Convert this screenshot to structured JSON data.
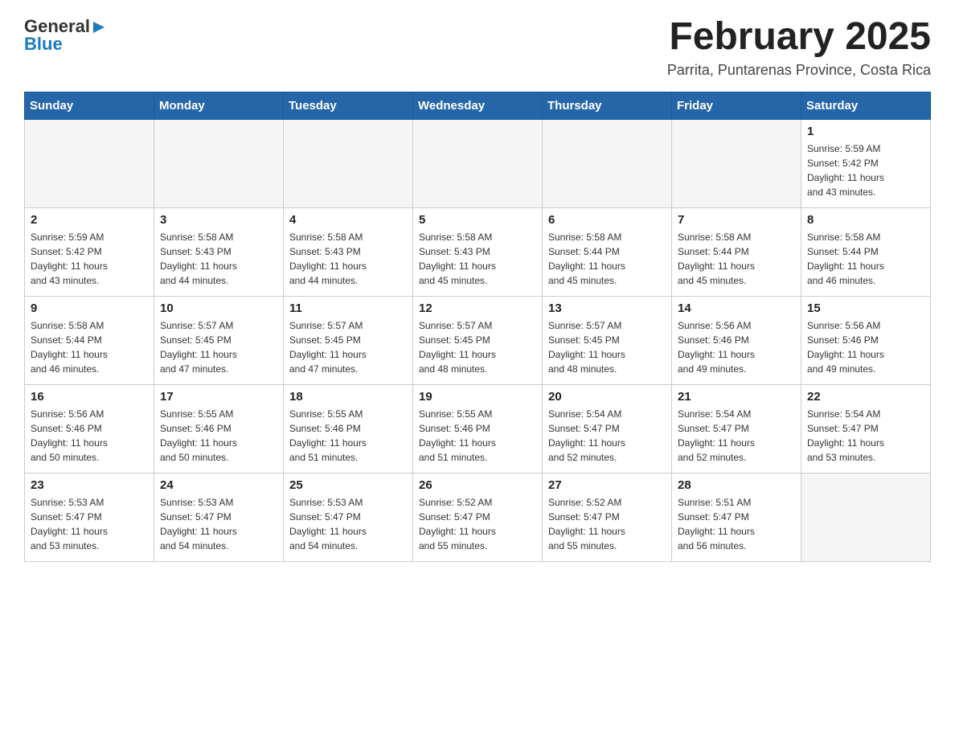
{
  "header": {
    "logo_general": "General",
    "logo_blue": "Blue",
    "title": "February 2025",
    "subtitle": "Parrita, Puntarenas Province, Costa Rica"
  },
  "weekdays": [
    "Sunday",
    "Monday",
    "Tuesday",
    "Wednesday",
    "Thursday",
    "Friday",
    "Saturday"
  ],
  "weeks": [
    [
      {
        "day": "",
        "info": ""
      },
      {
        "day": "",
        "info": ""
      },
      {
        "day": "",
        "info": ""
      },
      {
        "day": "",
        "info": ""
      },
      {
        "day": "",
        "info": ""
      },
      {
        "day": "",
        "info": ""
      },
      {
        "day": "1",
        "info": "Sunrise: 5:59 AM\nSunset: 5:42 PM\nDaylight: 11 hours\nand 43 minutes."
      }
    ],
    [
      {
        "day": "2",
        "info": "Sunrise: 5:59 AM\nSunset: 5:42 PM\nDaylight: 11 hours\nand 43 minutes."
      },
      {
        "day": "3",
        "info": "Sunrise: 5:58 AM\nSunset: 5:43 PM\nDaylight: 11 hours\nand 44 minutes."
      },
      {
        "day": "4",
        "info": "Sunrise: 5:58 AM\nSunset: 5:43 PM\nDaylight: 11 hours\nand 44 minutes."
      },
      {
        "day": "5",
        "info": "Sunrise: 5:58 AM\nSunset: 5:43 PM\nDaylight: 11 hours\nand 45 minutes."
      },
      {
        "day": "6",
        "info": "Sunrise: 5:58 AM\nSunset: 5:44 PM\nDaylight: 11 hours\nand 45 minutes."
      },
      {
        "day": "7",
        "info": "Sunrise: 5:58 AM\nSunset: 5:44 PM\nDaylight: 11 hours\nand 45 minutes."
      },
      {
        "day": "8",
        "info": "Sunrise: 5:58 AM\nSunset: 5:44 PM\nDaylight: 11 hours\nand 46 minutes."
      }
    ],
    [
      {
        "day": "9",
        "info": "Sunrise: 5:58 AM\nSunset: 5:44 PM\nDaylight: 11 hours\nand 46 minutes."
      },
      {
        "day": "10",
        "info": "Sunrise: 5:57 AM\nSunset: 5:45 PM\nDaylight: 11 hours\nand 47 minutes."
      },
      {
        "day": "11",
        "info": "Sunrise: 5:57 AM\nSunset: 5:45 PM\nDaylight: 11 hours\nand 47 minutes."
      },
      {
        "day": "12",
        "info": "Sunrise: 5:57 AM\nSunset: 5:45 PM\nDaylight: 11 hours\nand 48 minutes."
      },
      {
        "day": "13",
        "info": "Sunrise: 5:57 AM\nSunset: 5:45 PM\nDaylight: 11 hours\nand 48 minutes."
      },
      {
        "day": "14",
        "info": "Sunrise: 5:56 AM\nSunset: 5:46 PM\nDaylight: 11 hours\nand 49 minutes."
      },
      {
        "day": "15",
        "info": "Sunrise: 5:56 AM\nSunset: 5:46 PM\nDaylight: 11 hours\nand 49 minutes."
      }
    ],
    [
      {
        "day": "16",
        "info": "Sunrise: 5:56 AM\nSunset: 5:46 PM\nDaylight: 11 hours\nand 50 minutes."
      },
      {
        "day": "17",
        "info": "Sunrise: 5:55 AM\nSunset: 5:46 PM\nDaylight: 11 hours\nand 50 minutes."
      },
      {
        "day": "18",
        "info": "Sunrise: 5:55 AM\nSunset: 5:46 PM\nDaylight: 11 hours\nand 51 minutes."
      },
      {
        "day": "19",
        "info": "Sunrise: 5:55 AM\nSunset: 5:46 PM\nDaylight: 11 hours\nand 51 minutes."
      },
      {
        "day": "20",
        "info": "Sunrise: 5:54 AM\nSunset: 5:47 PM\nDaylight: 11 hours\nand 52 minutes."
      },
      {
        "day": "21",
        "info": "Sunrise: 5:54 AM\nSunset: 5:47 PM\nDaylight: 11 hours\nand 52 minutes."
      },
      {
        "day": "22",
        "info": "Sunrise: 5:54 AM\nSunset: 5:47 PM\nDaylight: 11 hours\nand 53 minutes."
      }
    ],
    [
      {
        "day": "23",
        "info": "Sunrise: 5:53 AM\nSunset: 5:47 PM\nDaylight: 11 hours\nand 53 minutes."
      },
      {
        "day": "24",
        "info": "Sunrise: 5:53 AM\nSunset: 5:47 PM\nDaylight: 11 hours\nand 54 minutes."
      },
      {
        "day": "25",
        "info": "Sunrise: 5:53 AM\nSunset: 5:47 PM\nDaylight: 11 hours\nand 54 minutes."
      },
      {
        "day": "26",
        "info": "Sunrise: 5:52 AM\nSunset: 5:47 PM\nDaylight: 11 hours\nand 55 minutes."
      },
      {
        "day": "27",
        "info": "Sunrise: 5:52 AM\nSunset: 5:47 PM\nDaylight: 11 hours\nand 55 minutes."
      },
      {
        "day": "28",
        "info": "Sunrise: 5:51 AM\nSunset: 5:47 PM\nDaylight: 11 hours\nand 56 minutes."
      },
      {
        "day": "",
        "info": ""
      }
    ]
  ]
}
